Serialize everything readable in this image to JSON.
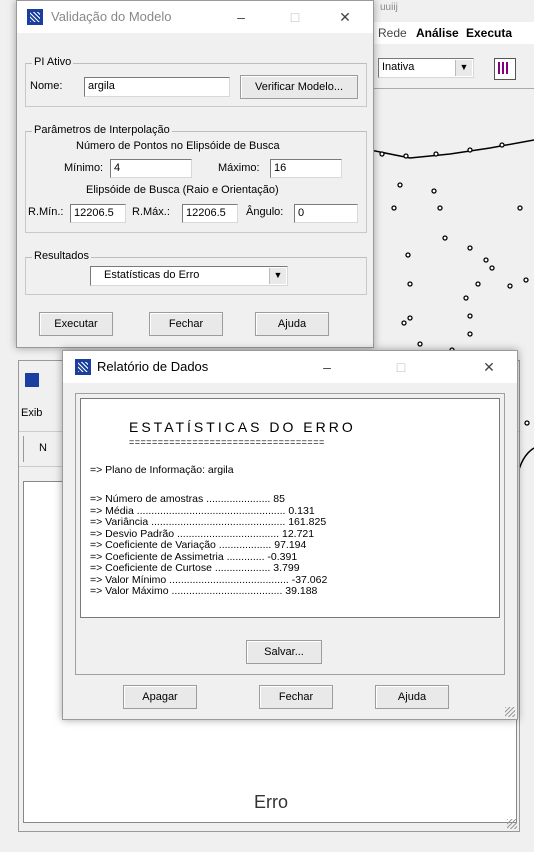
{
  "bg_app": {
    "menu": [
      "l Rede",
      "Análise",
      "Executa"
    ],
    "status_combo": "Inativa",
    "top_fragment": "uuiij"
  },
  "back_window": {
    "menu_fragment": "Exib",
    "toolbar_fragment": "N",
    "bottom_text": "Erro"
  },
  "validation_dialog": {
    "title": "Validação do Modelo",
    "pi_group": "PI Ativo",
    "name_label": "Nome:",
    "name_value": "argila",
    "verify_button": "Verificar Modelo...",
    "interp_group": "Parâmetros de Interpolação",
    "points_heading": "Número de Pontos no Elipsóide de Busca",
    "min_label": "Mínimo:",
    "min_value": "4",
    "max_label": "Máximo:",
    "max_value": "16",
    "ellipsoid_heading": "Elipsóide de Busca (Raio e Orientação)",
    "rmin_label": "R.Mín.:",
    "rmin_value": "12206.5",
    "rmax_label": "R.Máx.:",
    "rmax_value": "12206.5",
    "angle_label": "Ângulo:",
    "angle_value": "0",
    "results_group": "Resultados",
    "results_selected": "Estatísticas do Erro",
    "execute_button": "Executar",
    "close_button": "Fechar",
    "help_button": "Ajuda"
  },
  "report_dialog": {
    "title": "Relatório de Dados",
    "heading": "ESTATÍSTICAS DO ERRO",
    "underline": "==================================",
    "plano": "=> Plano de Informação: argila",
    "stats": [
      {
        "label": "=> Número de amostras ......................",
        "value": "85"
      },
      {
        "label": "=> Média ...................................................",
        "value": "0.131"
      },
      {
        "label": "=> Variância ..............................................",
        "value": "161.825"
      },
      {
        "label": "=> Desvio Padrão ...................................",
        "value": "12.721"
      },
      {
        "label": "=> Coeficiente de Variação ..................",
        "value": "97.194"
      },
      {
        "label": "=> Coeficiente de Assimetria .............",
        "value": "-0.391"
      },
      {
        "label": "=> Coeficiente de Curtose ...................",
        "value": "3.799"
      },
      {
        "label": "=> Valor Mínimo .........................................",
        "value": "-37.062"
      },
      {
        "label": "=> Valor Máximo ......................................",
        "value": "39.188"
      }
    ],
    "save_button": "Salvar...",
    "clear_button": "Apagar",
    "close_button": "Fechar",
    "help_button": "Ajuda"
  }
}
